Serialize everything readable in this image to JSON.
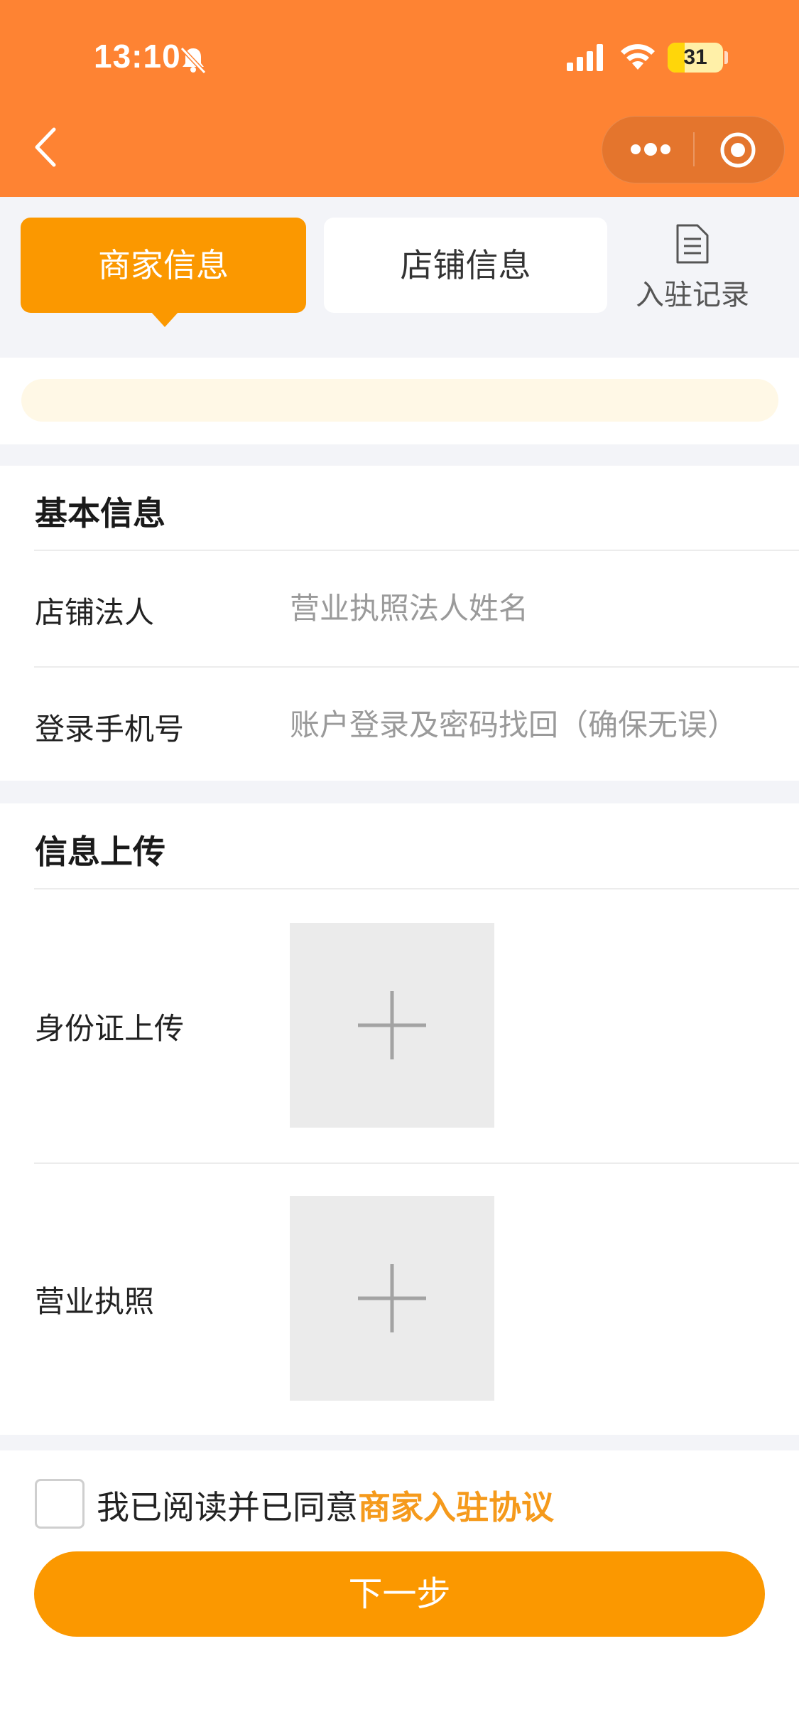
{
  "status_bar": {
    "time": "13:10",
    "battery": "31",
    "battery_percent": 31,
    "icons": [
      "bell-muted-icon",
      "signal-icon",
      "wifi-icon",
      "battery-icon"
    ]
  },
  "nav": {
    "icons": [
      "back-icon",
      "more-icon",
      "target-icon"
    ]
  },
  "tabs": [
    {
      "label": "商家信息",
      "active": true
    },
    {
      "label": "店铺信息",
      "active": false
    }
  ],
  "record": {
    "label": "入驻记录",
    "icon": "document-icon"
  },
  "basic_info": {
    "title": "基本信息",
    "fields": [
      {
        "label": "店铺法人",
        "placeholder": "营业执照法人姓名",
        "value": ""
      },
      {
        "label": "登录手机号",
        "placeholder": "账户登录及密码找回（确保无误）",
        "value": ""
      }
    ]
  },
  "upload_info": {
    "title": "信息上传",
    "items": [
      {
        "label": "身份证上传",
        "icon": "plus-icon"
      },
      {
        "label": "营业执照",
        "icon": "plus-icon"
      }
    ]
  },
  "agreement": {
    "text": "我已阅读并已同意",
    "link": "商家入驻协议",
    "checked": false
  },
  "next_button": "下一步",
  "colors": {
    "header": "#fe8333",
    "accent": "#fb9800",
    "link": "#f59a1c",
    "background": "#f3f4f8"
  }
}
